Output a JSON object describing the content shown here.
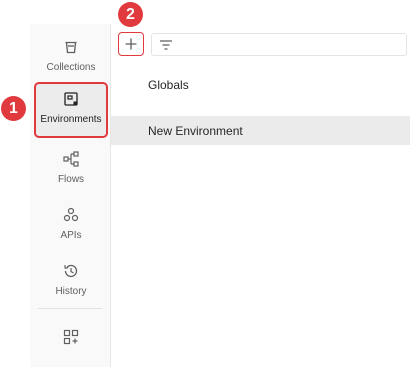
{
  "sidebar": {
    "items": [
      {
        "label": "Collections",
        "icon": "collections-icon"
      },
      {
        "label": "Environments",
        "icon": "environments-icon",
        "selected": true
      },
      {
        "label": "Flows",
        "icon": "flows-icon"
      },
      {
        "label": "APIs",
        "icon": "apis-icon"
      },
      {
        "label": "History",
        "icon": "history-icon"
      }
    ],
    "configure_icon": "add-workbench-icon"
  },
  "toolbar": {
    "add_icon": "plus-icon",
    "filter_icon": "filter-icon"
  },
  "environments": [
    {
      "name": "Globals"
    },
    {
      "name": "New Environment",
      "active": true
    }
  ],
  "callouts": [
    "1",
    "2"
  ],
  "colors": {
    "accent": "#e0393e",
    "sidebar_bg": "#f9f9f9",
    "active_row_bg": "#ebebeb"
  }
}
